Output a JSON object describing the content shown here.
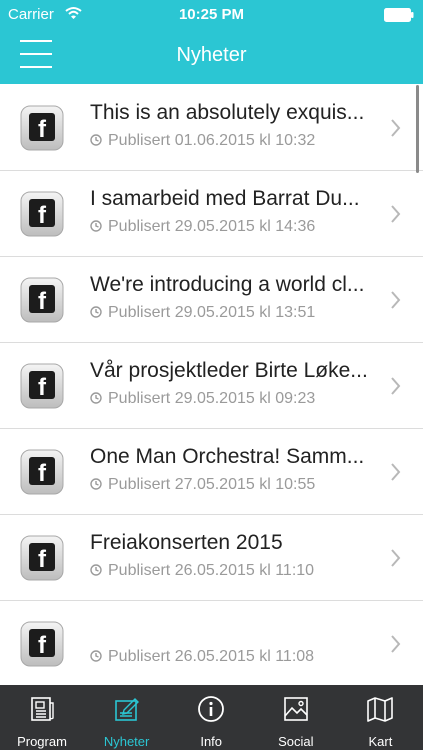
{
  "status": {
    "carrier": "Carrier",
    "time": "10:25 PM"
  },
  "header": {
    "title": "Nyheter"
  },
  "colors": {
    "accent": "#2bc6d3",
    "tabbar": "#333436"
  },
  "news": [
    {
      "title": "This is an absolutely exquis...",
      "meta": "Publisert 01.06.2015 kl 10:32"
    },
    {
      "title": "I samarbeid med Barrat Du...",
      "meta": "Publisert 29.05.2015 kl 14:36"
    },
    {
      "title": "We're introducing a world cl...",
      "meta": "Publisert 29.05.2015 kl 13:51"
    },
    {
      "title": "Vår prosjektleder Birte Løke...",
      "meta": "Publisert 29.05.2015 kl 09:23"
    },
    {
      "title": "One Man Orchestra! Samm...",
      "meta": "Publisert 27.05.2015 kl 10:55"
    },
    {
      "title": "Freiakonserten 2015",
      "meta": "Publisert 26.05.2015 kl 11:10"
    },
    {
      "title": "",
      "meta": "Publisert 26.05.2015 kl 11:08"
    }
  ],
  "tabs": [
    {
      "label": "Program",
      "icon": "newspaper-icon",
      "active": false
    },
    {
      "label": "Nyheter",
      "icon": "news-edit-icon",
      "active": true
    },
    {
      "label": "Info",
      "icon": "info-icon",
      "active": false
    },
    {
      "label": "Social",
      "icon": "picture-icon",
      "active": false
    },
    {
      "label": "Kart",
      "icon": "map-icon",
      "active": false
    }
  ]
}
